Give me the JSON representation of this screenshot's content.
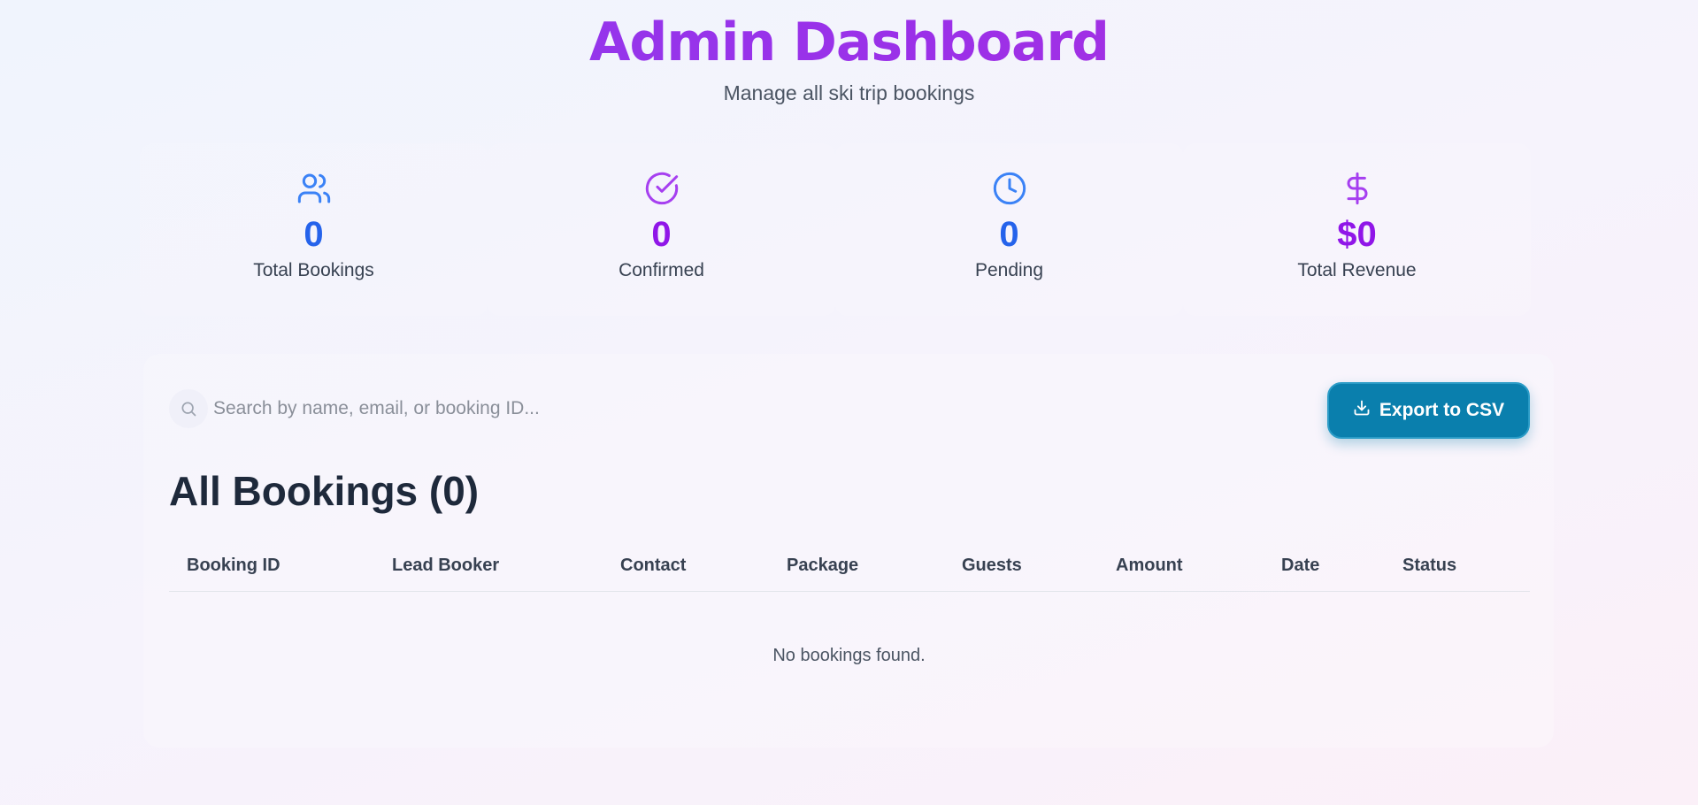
{
  "header": {
    "title": "Admin Dashboard",
    "subtitle": "Manage all ski trip bookings"
  },
  "stats": [
    {
      "icon": "users-icon",
      "value": "0",
      "label": "Total Bookings",
      "color": "#2563eb"
    },
    {
      "icon": "check-circle-icon",
      "value": "0",
      "label": "Confirmed",
      "color": "#9016e8"
    },
    {
      "icon": "clock-icon",
      "value": "0",
      "label": "Pending",
      "color": "#2563eb"
    },
    {
      "icon": "dollar-icon",
      "value": "$0",
      "label": "Total Revenue",
      "color": "#9016e8"
    }
  ],
  "search": {
    "placeholder": "Search by name, email, or booking ID...",
    "value": ""
  },
  "export_button": {
    "label": "Export to CSV",
    "icon": "download-icon",
    "color": "#0a7fad"
  },
  "bookings": {
    "title": "All Bookings (0)",
    "columns": [
      "Booking ID",
      "Lead Booker",
      "Contact",
      "Package",
      "Guests",
      "Amount",
      "Date",
      "Status"
    ],
    "rows": [],
    "empty_message": "No bookings found."
  }
}
